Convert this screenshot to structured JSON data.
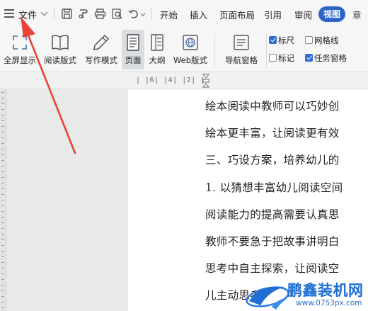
{
  "menubar": {
    "file_label": "文件",
    "tabs": [
      {
        "label": "开始"
      },
      {
        "label": "插入"
      },
      {
        "label": "页面布局"
      },
      {
        "label": "引用"
      },
      {
        "label": "审阅"
      },
      {
        "label": "视图",
        "active": true
      },
      {
        "label": "章"
      }
    ],
    "active_color": "#2e64c6"
  },
  "ribbon": {
    "buttons": [
      {
        "label": "全屏显示"
      },
      {
        "label": "阅读版式"
      },
      {
        "label": "写作模式"
      },
      {
        "label": "页面",
        "selected": true
      },
      {
        "label": "大纲"
      },
      {
        "label": "Web版式"
      },
      {
        "label": "导航窗格"
      }
    ],
    "checks": [
      {
        "label": "标尺",
        "checked": true
      },
      {
        "label": "网格线",
        "checked": false
      },
      {
        "label": "标记",
        "checked": false
      },
      {
        "label": "任务窗格",
        "checked": true
      }
    ],
    "check_color": "#2f6cd4"
  },
  "ruler": {
    "text": "| |6| |4| |2| |"
  },
  "document": {
    "lines": [
      "绘本阅读中教师可以巧妙创",
      "绘本更丰富，让阅读更有效",
      "三、巧设方案，培养幼儿的",
      "1. 以猜想丰富幼儿阅读空间",
      "阅读能力的提高需要认真思",
      "教师不要急于把故事讲明白",
      "思考中自主探索，让阅读空",
      "儿主动思考"
    ]
  },
  "watermark": {
    "title": "鹏鑫装机网",
    "url": "www.0753px.com"
  },
  "annotation": {
    "arrow_color": "#e8423a"
  }
}
